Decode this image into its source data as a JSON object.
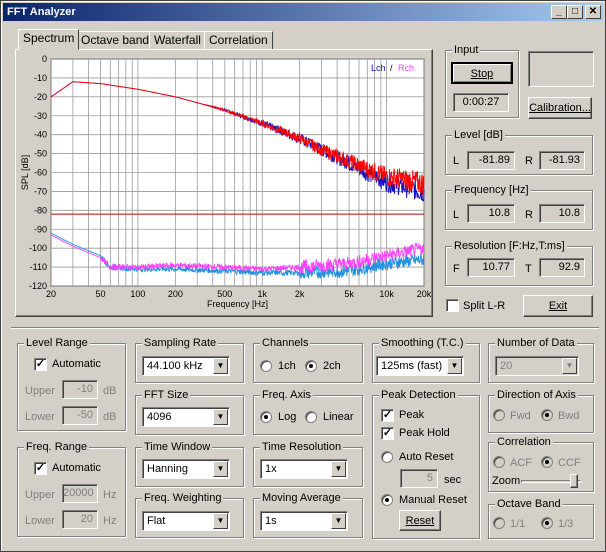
{
  "window": {
    "title": "FFT Analyzer",
    "min": "_",
    "max": "□",
    "close": "✕"
  },
  "tabs": [
    "Spectrum",
    "Octave band",
    "Waterfall",
    "Correlation"
  ],
  "chart_data": {
    "type": "line",
    "xlabel": "Frequency [Hz]",
    "ylabel": "SPL [dB]",
    "x_scale": "log",
    "xlim": [
      20,
      20000
    ],
    "ylim": [
      -120,
      0
    ],
    "xticks": [
      "20",
      "50",
      "100",
      "200",
      "500",
      "1k",
      "2k",
      "5k",
      "10k",
      "20k"
    ],
    "yticks": [
      "0",
      "-10",
      "-20",
      "-30",
      "-40",
      "-50",
      "-60",
      "-70",
      "-80",
      "-90",
      "-100",
      "-110",
      "-120"
    ],
    "legend": {
      "lch": "Lch",
      "sep": "/",
      "rch": "Rch",
      "position": "top-right"
    },
    "series": [
      {
        "name": "Lch",
        "color": "#1010c0",
        "x": [
          20,
          30,
          50,
          100,
          200,
          500,
          1000,
          2000,
          3000,
          5000,
          7000,
          10000,
          15000,
          20000
        ],
        "y": [
          -20,
          -12,
          -13,
          -16,
          -20,
          -27,
          -34,
          -42,
          -48,
          -55,
          -60,
          -65,
          -68,
          -70
        ]
      },
      {
        "name": "Rch",
        "color": "#ff0000",
        "x": [
          20,
          30,
          50,
          100,
          200,
          500,
          1000,
          2000,
          3000,
          5000,
          7000,
          10000,
          15000,
          20000
        ],
        "y": [
          -20,
          -12,
          -13,
          -16,
          -20,
          -27,
          -34,
          -42,
          -48,
          -54,
          -58,
          -62,
          -64,
          -66
        ]
      },
      {
        "name": "Lch noise",
        "color": "#2090e0",
        "x": [
          20,
          30,
          50,
          60,
          100,
          200,
          500,
          1000,
          2000,
          5000,
          10000,
          20000
        ],
        "y": [
          -92,
          -98,
          -104,
          -110,
          -111,
          -111,
          -112,
          -113,
          -113,
          -112,
          -108,
          -106
        ]
      },
      {
        "name": "Rch noise",
        "color": "#ff40ff",
        "x": [
          20,
          30,
          50,
          60,
          100,
          200,
          500,
          1000,
          2000,
          5000,
          10000,
          20000
        ],
        "y": [
          -93,
          -99,
          -105,
          -110,
          -110,
          -109,
          -110,
          -111,
          -110,
          -108,
          -104,
          -100
        ]
      }
    ],
    "threshold_line": {
      "y": -82,
      "color": "#c00000"
    }
  },
  "input": {
    "label": "Input",
    "stop": "Stop",
    "time": "0:00:27",
    "calibration": "Calibration..."
  },
  "level": {
    "label": "Level [dB]",
    "l": "L",
    "l_val": "-81.89",
    "r": "R",
    "r_val": "-81.93"
  },
  "frequency": {
    "label": "Frequency [Hz]",
    "l": "L",
    "l_val": "10.8",
    "r": "R",
    "r_val": "10.8"
  },
  "resolution": {
    "label": "Resolution [F:Hz,T:ms]",
    "f": "F",
    "f_val": "10.77",
    "t": "T",
    "t_val": "92.9"
  },
  "split": {
    "label": "Split L-R"
  },
  "exit": "Exit",
  "level_range": {
    "label": "Level Range",
    "automatic": "Automatic",
    "upper": "Upper",
    "upper_val": "-10",
    "lower": "Lower",
    "lower_val": "-50",
    "unit": "dB"
  },
  "freq_range": {
    "label": "Freq. Range",
    "automatic": "Automatic",
    "upper": "Upper",
    "upper_val": "20000",
    "lower": "Lower",
    "lower_val": "20",
    "unit": "Hz"
  },
  "sampling_rate": {
    "label": "Sampling Rate",
    "value": "44.100 kHz"
  },
  "fft_size": {
    "label": "FFT Size",
    "value": "4096"
  },
  "time_window": {
    "label": "Time Window",
    "value": "Hanning"
  },
  "freq_weighting": {
    "label": "Freq. Weighting",
    "value": "Flat"
  },
  "channels": {
    "label": "Channels",
    "opt1": "1ch",
    "opt2": "2ch"
  },
  "freq_axis": {
    "label": "Freq. Axis",
    "opt1": "Log",
    "opt2": "Linear"
  },
  "time_resolution": {
    "label": "Time Resolution",
    "value": "1x"
  },
  "moving_average": {
    "label": "Moving Average",
    "value": "1s"
  },
  "smoothing": {
    "label": "Smoothing (T.C.)",
    "value": "125ms (fast)"
  },
  "peak": {
    "label": "Peak Detection",
    "peak": "Peak",
    "peak_hold": "Peak Hold",
    "auto_reset": "Auto Reset",
    "sec_val": "5",
    "sec": "sec",
    "manual_reset": "Manual Reset",
    "reset": "Reset"
  },
  "num_data": {
    "label": "Number of Data",
    "value": "20"
  },
  "direction": {
    "label": "Direction of Axis",
    "fwd": "Fwd",
    "bwd": "Bwd"
  },
  "correlation": {
    "label": "Correlation",
    "acf": "ACF",
    "ccf": "CCF",
    "zoom": "Zoom"
  },
  "octave_band": {
    "label": "Octave Band",
    "opt1": "1/1",
    "opt2": "1/3"
  }
}
